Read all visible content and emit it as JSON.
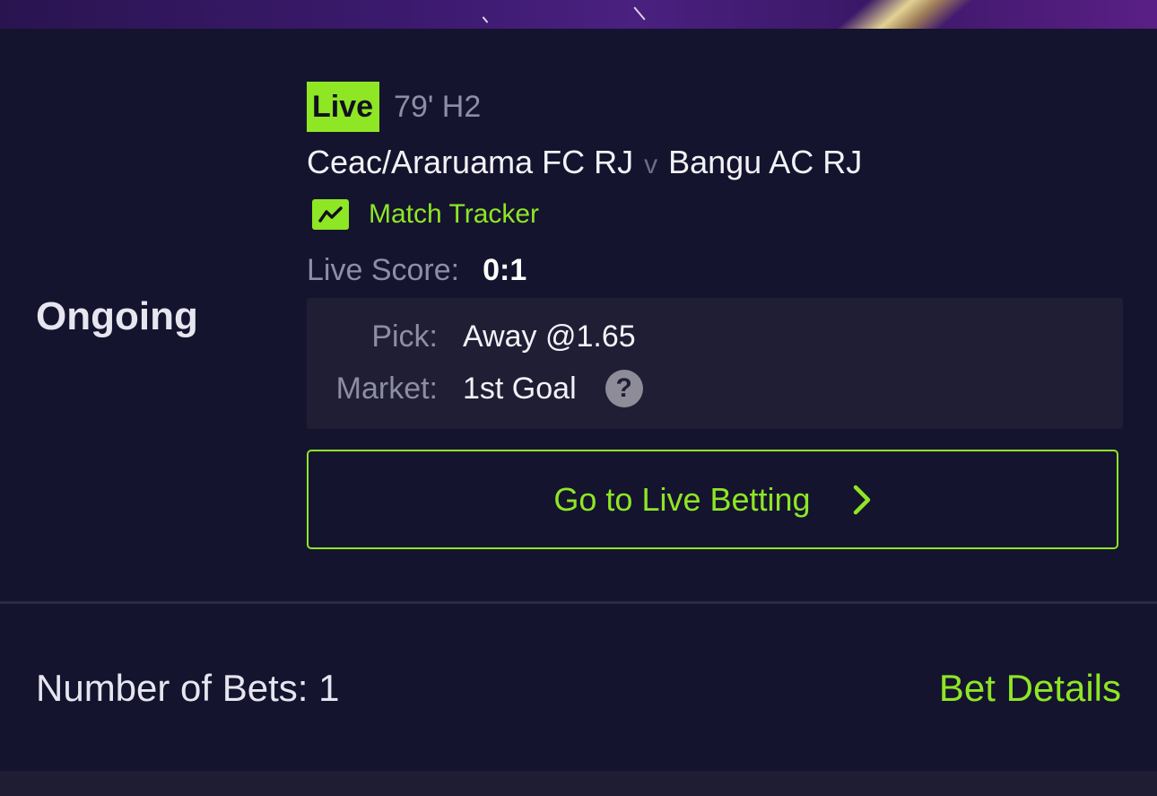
{
  "bet_card": {
    "status_label": "Ongoing",
    "live_badge": "Live",
    "match_time": "79' H2",
    "home_team": "Ceac/Araruama FC RJ",
    "versus": "v",
    "away_team": "Bangu AC RJ",
    "match_tracker_label": "Match Tracker",
    "match_tracker_icon": "chart-line-icon",
    "live_score_label": "Live Score:",
    "live_score_value": "0:1",
    "pick_label": "Pick:",
    "pick_value": "Away @1.65",
    "market_label": "Market:",
    "market_value": "1st Goal",
    "help_icon_glyph": "?",
    "live_betting_button": "Go to Live Betting"
  },
  "footer": {
    "number_of_bets": "Number of Bets: 1",
    "bet_details_link": "Bet Details"
  },
  "colors": {
    "accent": "#8ee625",
    "background": "#15142e",
    "panel": "#1f1e35",
    "muted_text": "#8e8da6"
  }
}
